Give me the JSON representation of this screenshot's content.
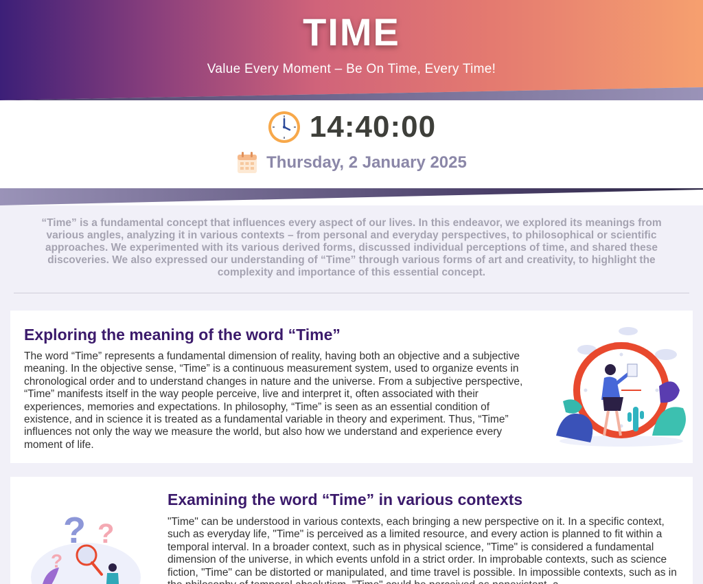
{
  "header": {
    "title": "TIME",
    "tagline": "Value Every Moment – Be On Time, Every Time!"
  },
  "clock": {
    "time": "14:40:00",
    "date": "Thursday, 2 January 2025",
    "clock_icon": "clock-icon",
    "calendar_icon": "calendar-icon"
  },
  "intro": "“Time” is a fundamental concept that influences every aspect of our lives. In this endeavor, we explored its meanings from various angles, analyzing it in various contexts – from personal and everyday perspectives, to philosophical or scientific approaches. We experimented with its various derived forms, discussed individual perceptions of time, and shared these discoveries. We also expressed our understanding of “Time” through various forms of art and creativity, to highlight the complexity and importance of this essential concept.",
  "sections": [
    {
      "title": "Exploring the meaning of the word “Time”",
      "text": "The word “Time” represents a fundamental dimension of reality, having both an objective and a subjective meaning. In the objective sense, “Time” is a continuous measurement system, used to organize events in chronological order and to understand changes in nature and the universe. From a subjective perspective, “Time” manifests itself in the way people perceive, live and interpret it, often associated with their experiences, memories and expectations. In philosophy, “Time” is seen as an essential condition of existence, and in science it is treated as a fundamental variable in theory and experiment. Thus, “Time” influences not only the way we measure the world, but also how we understand and experience every moment of life."
    },
    {
      "title": "Examining the word “Time” in various contexts",
      "text": "\"Time\" can be understood in various contexts, each bringing a new perspective on it. In a specific context, such as everyday life, \"Time\" is perceived as a limited resource, and every action is planned to fit within a temporal interval. In a broader context, such as in physical science, \"Time\" is considered a fundamental dimension of the universe, in which events unfold in a strict order. In improbable contexts, such as science fiction, \"Time\" can be distorted or manipulated, and time travel is possible. In impossible contexts, such as in the philosophy of temporal absolutism, \"Time\" could be perceived as nonexistent, a"
    }
  ],
  "colors": {
    "heading": "#3b1a6b",
    "gradient_start": "#3c1f78",
    "gradient_end": "#f6a06f"
  }
}
